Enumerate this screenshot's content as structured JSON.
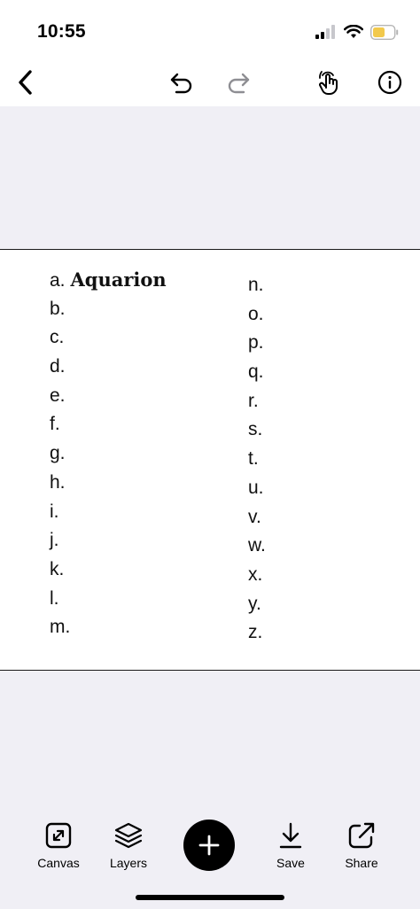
{
  "status": {
    "time": "10:55"
  },
  "toolbar": {
    "back": "chevron-left-icon",
    "undo": "undo-icon",
    "redo": "redo-icon",
    "touch": "hand-pointer-icon",
    "info": "info-icon"
  },
  "document": {
    "left_items": [
      {
        "letter": "a.",
        "text": "Aquarion"
      },
      {
        "letter": "b.",
        "text": ""
      },
      {
        "letter": "c.",
        "text": ""
      },
      {
        "letter": "d.",
        "text": ""
      },
      {
        "letter": "e.",
        "text": ""
      },
      {
        "letter": "f.",
        "text": ""
      },
      {
        "letter": "g.",
        "text": ""
      },
      {
        "letter": "h.",
        "text": ""
      },
      {
        "letter": "i.",
        "text": ""
      },
      {
        "letter": "j.",
        "text": ""
      },
      {
        "letter": "k.",
        "text": ""
      },
      {
        "letter": "l.",
        "text": ""
      },
      {
        "letter": "m.",
        "text": ""
      }
    ],
    "right_items": [
      {
        "letter": "n."
      },
      {
        "letter": "o."
      },
      {
        "letter": "p."
      },
      {
        "letter": "q."
      },
      {
        "letter": "r."
      },
      {
        "letter": "s."
      },
      {
        "letter": "t."
      },
      {
        "letter": "u."
      },
      {
        "letter": "v."
      },
      {
        "letter": "w."
      },
      {
        "letter": "x."
      },
      {
        "letter": "y."
      },
      {
        "letter": "z."
      }
    ]
  },
  "bottom": {
    "canvas_label": "Canvas",
    "layers_label": "Layers",
    "save_label": "Save",
    "share_label": "Share"
  }
}
